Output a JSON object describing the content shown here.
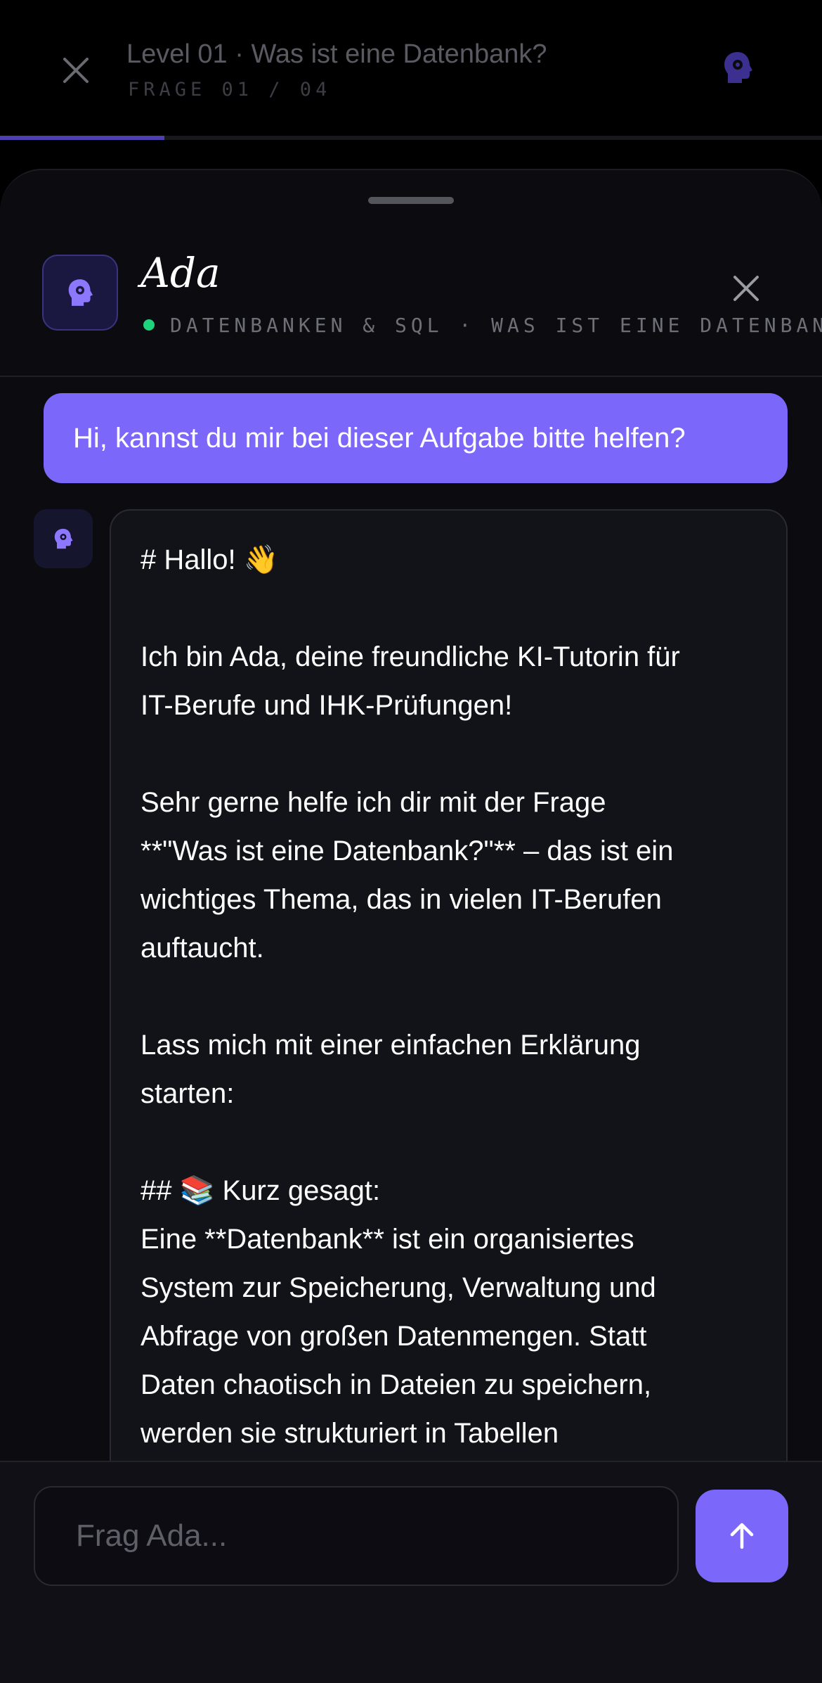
{
  "quiz_header": {
    "title": "Level 01 · Was ist eine Datenbank?",
    "question_counter": "FRAGE 01 / 04",
    "progress": 0.2,
    "close_icon": "close-icon",
    "tutor_icon": "brain-gear-icon"
  },
  "tutor_sheet": {
    "name": "Ada",
    "status_color": "#1fd27c",
    "context": "DATENBANKEN & SQL · WAS IST EINE DATENBANK?",
    "close_icon": "close-icon"
  },
  "chat": {
    "messages": [
      {
        "role": "user",
        "text": "Hi, kannst du mir bei dieser Aufgabe bitte helfen?"
      },
      {
        "role": "assistant",
        "lines": [
          "# Hallo! 👋",
          "",
          "Ich bin Ada, deine freundliche KI-Tutorin für",
          "IT-Berufe und IHK-Prüfungen!",
          "",
          "Sehr gerne helfe ich dir mit der Frage",
          "**\"Was ist eine Datenbank?\"** – das ist ein",
          "wichtiges Thema, das in vielen IT-Berufen",
          "auftaucht.",
          "",
          "Lass mich mit einer einfachen Erklärung",
          "starten:",
          "",
          "## 📚  Kurz gesagt:",
          "Eine **Datenbank** ist ein organisiertes",
          "System zur Speicherung, Verwaltung und",
          "Abfrage von großen Datenmengen. Statt",
          "Daten chaotisch in Dateien zu speichern,",
          "werden sie strukturiert in Tabellen"
        ]
      }
    ]
  },
  "composer": {
    "placeholder": "Frag Ada...",
    "value": "",
    "send_icon": "arrow-up-icon"
  },
  "colors": {
    "accent": "#7b68fa",
    "background": "#0b0b10",
    "online": "#1fd27c"
  }
}
